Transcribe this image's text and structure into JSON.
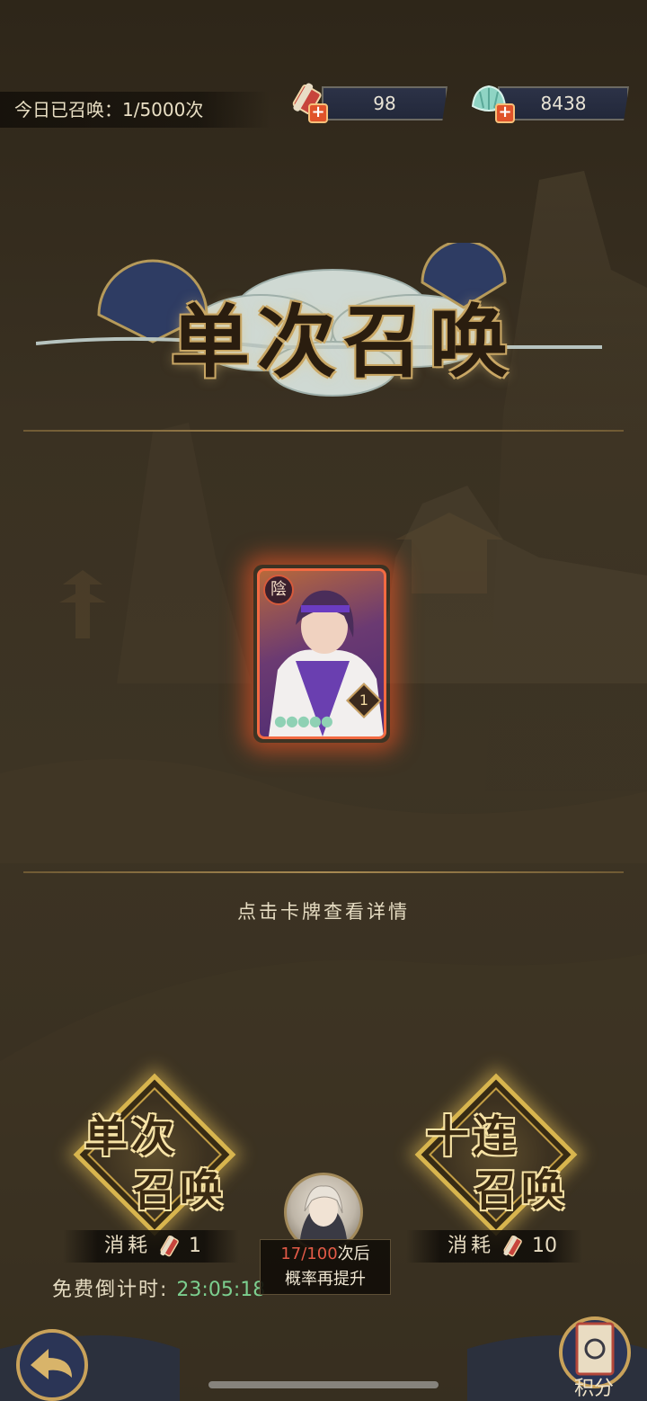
{
  "top_bar": {
    "daily_summon_count": "今日已召唤：1/5000次",
    "currency_1_value": "98",
    "currency_2_value": "8438",
    "currency_1_icon": "scroll-icon",
    "currency_2_icon": "jade-shell-icon"
  },
  "title": "单次召唤",
  "card": {
    "badge_char": "陰",
    "level": "1",
    "stars": "●●●●●",
    "frame_color": "#f26a42"
  },
  "hint_text": "点击卡牌查看详情",
  "summon_single": {
    "line1": "单次",
    "line2": "召唤",
    "cost_label": "消耗",
    "cost_value": "1"
  },
  "summon_ten": {
    "line1": "十连",
    "line2": "召唤",
    "cost_label": "消耗",
    "cost_value": "10"
  },
  "free_timer": {
    "label": "免费倒计时:",
    "time": "23:05:18"
  },
  "pity": {
    "count": "17/100",
    "line1_suffix": "次后",
    "line2": "概率再提升"
  },
  "points_label": "积分",
  "colors": {
    "accent_gold": "#d8b54e",
    "timer_green": "#7ccf8f",
    "pity_red": "#e35a47"
  }
}
